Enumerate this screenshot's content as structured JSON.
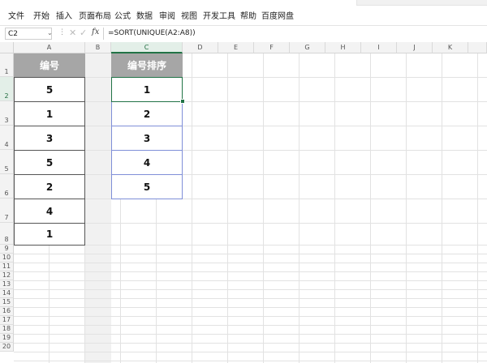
{
  "menu": [
    "文件",
    "开始",
    "插入",
    "页面布局",
    "公式",
    "数据",
    "审阅",
    "视图",
    "开发工具",
    "帮助",
    "百度网盘"
  ],
  "formula_bar": {
    "name_box": "C2",
    "fx_label": "fx",
    "formula": "=SORT(UNIQUE(A2:A8))"
  },
  "columns": [
    "A",
    "B",
    "C",
    "D",
    "E",
    "F",
    "G",
    "H",
    "I",
    "J",
    "K"
  ],
  "rows": [
    "1",
    "2",
    "3",
    "4",
    "5",
    "6",
    "7",
    "8",
    "9",
    "10",
    "11",
    "12",
    "13",
    "14",
    "15",
    "16",
    "17",
    "18",
    "19",
    "20"
  ],
  "selected_cell": "C2",
  "table_a": {
    "header": "编号",
    "values": [
      "5",
      "1",
      "3",
      "5",
      "2",
      "4",
      "1"
    ]
  },
  "table_c": {
    "header": "编号排序",
    "values": [
      "1",
      "2",
      "3",
      "4",
      "5"
    ]
  },
  "colors": {
    "header_fill": "#a6a6a6",
    "selection": "#217346",
    "spill_border": "#7f8fd8"
  }
}
